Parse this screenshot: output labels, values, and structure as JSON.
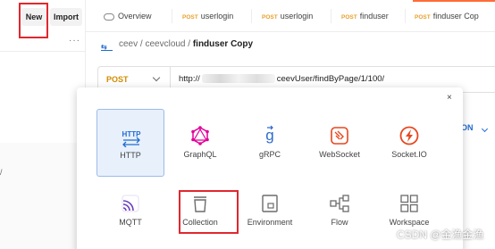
{
  "sidebar": {
    "new_label": "New",
    "import_label": "Import",
    "more_label": "···",
    "partial_text": "/"
  },
  "tabs": [
    {
      "method": "",
      "label": "Overview"
    },
    {
      "method": "POST",
      "label": "userlogin"
    },
    {
      "method": "POST",
      "label": "userlogin"
    },
    {
      "method": "POST",
      "label": "finduser"
    },
    {
      "method": "POST",
      "label": "finduser Cop"
    }
  ],
  "breadcrumb": {
    "part1": "ceev",
    "sep1": "/",
    "part2": "ceevcloud",
    "sep2": "/",
    "current": "finduser Copy"
  },
  "request": {
    "method": "POST",
    "url_start": "http://",
    "url_end": "ceevUser/findByPage/1/100/"
  },
  "right_partial": "ON",
  "modal": {
    "close_label": "×",
    "items": [
      {
        "label": "HTTP",
        "icon": "http-icon",
        "selected": true
      },
      {
        "label": "GraphQL",
        "icon": "graphql-icon",
        "selected": false
      },
      {
        "label": "gRPC",
        "icon": "grpc-icon",
        "selected": false
      },
      {
        "label": "WebSocket",
        "icon": "websocket-icon",
        "selected": false
      },
      {
        "label": "Socket.IO",
        "icon": "socketio-icon",
        "selected": false
      },
      {
        "label": "MQTT",
        "icon": "mqtt-icon",
        "selected": false
      },
      {
        "label": "Collection",
        "icon": "collection-icon",
        "selected": false
      },
      {
        "label": "Environment",
        "icon": "environment-icon",
        "selected": false
      },
      {
        "label": "Flow",
        "icon": "flow-icon",
        "selected": false
      },
      {
        "label": "Workspace",
        "icon": "workspace-icon",
        "selected": false
      }
    ]
  },
  "watermark": "CSDN @金渔金渔",
  "colors": {
    "accent": "#ff6c37",
    "post_method": "#e8a02c",
    "annotation_red": "#e0282e",
    "http_blue": "#1f6ccf",
    "graphql_pink": "#e10098",
    "grpc_blue": "#2d6bcc",
    "websocket_red": "#e8461e",
    "socketio_red": "#e8461e",
    "mqtt_purple": "#6a3dbb"
  }
}
